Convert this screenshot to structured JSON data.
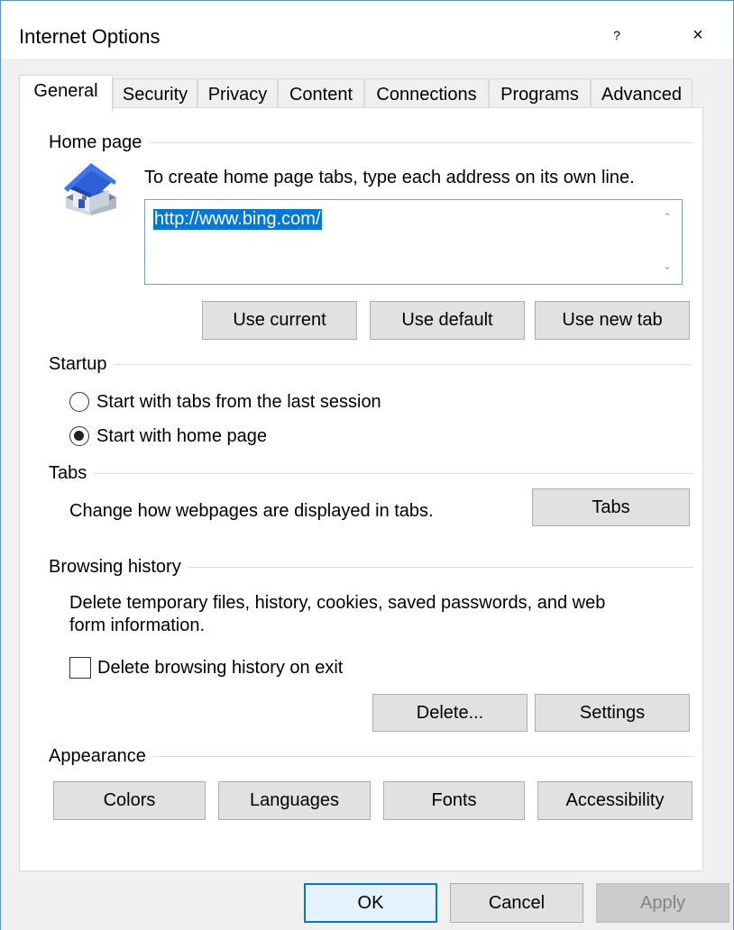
{
  "window": {
    "title": "Internet Options",
    "help_label": "?",
    "close_label": "×"
  },
  "tabs": [
    {
      "label": "General",
      "active": true
    },
    {
      "label": "Security"
    },
    {
      "label": "Privacy"
    },
    {
      "label": "Content"
    },
    {
      "label": "Connections"
    },
    {
      "label": "Programs"
    },
    {
      "label": "Advanced"
    }
  ],
  "home_page": {
    "group_label": "Home page",
    "instruction": "To create home page tabs, type each address on its own line.",
    "address_value": "http://www.bing.com/",
    "icon": "house-icon",
    "buttons": {
      "use_current": "Use current",
      "use_default": "Use default",
      "use_new_tab": "Use new tab"
    }
  },
  "startup": {
    "group_label": "Startup",
    "option_last_session": "Start with tabs from the last session",
    "option_home_page": "Start with home page",
    "selected": "home_page"
  },
  "tabs_group": {
    "group_label": "Tabs",
    "description": "Change how webpages are displayed in tabs.",
    "button": "Tabs"
  },
  "browsing_history": {
    "group_label": "Browsing history",
    "description_line1": "Delete temporary files, history, cookies, saved passwords, and web",
    "description_line2": "form information.",
    "checkbox_label": "Delete browsing history on exit",
    "checkbox_checked": false,
    "delete_button": "Delete...",
    "settings_button": "Settings"
  },
  "appearance": {
    "group_label": "Appearance",
    "colors": "Colors",
    "languages": "Languages",
    "fonts": "Fonts",
    "accessibility": "Accessibility"
  },
  "footer": {
    "ok": "OK",
    "cancel": "Cancel",
    "apply": "Apply"
  },
  "colors": {
    "accent": "#0078d7",
    "selection_bg": "#0078d7",
    "window_border": "#5b8fd6"
  }
}
